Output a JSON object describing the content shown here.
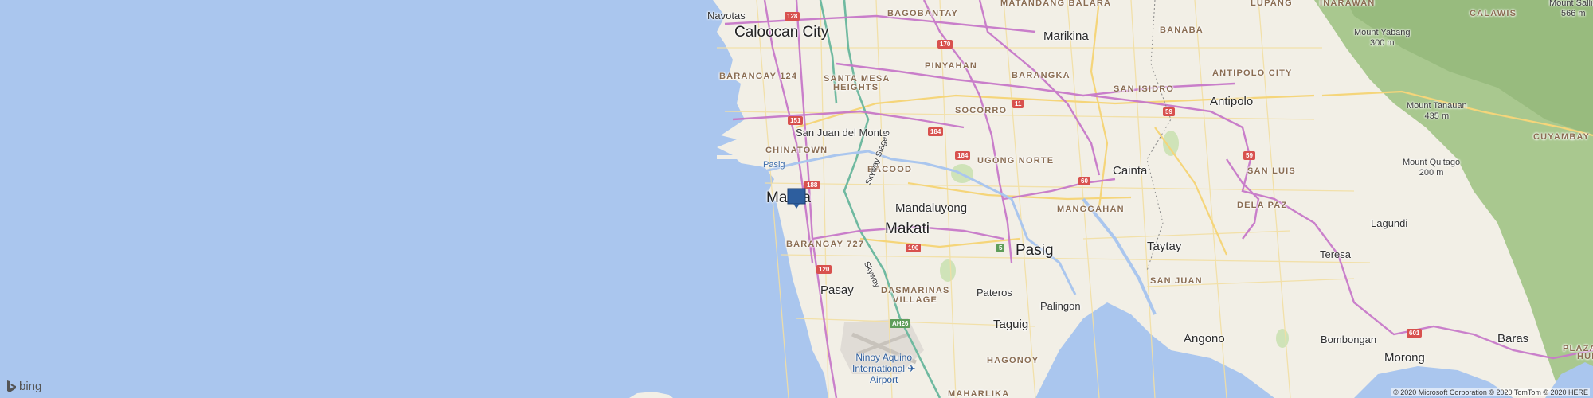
{
  "map": {
    "provider_logo": "bing",
    "copyright": "© 2020 Microsoft Corporation © 2020 TomTom © 2020 HERE",
    "marker_icon": "location-pin-icon",
    "colors": {
      "water": "#aac6ee",
      "land": "#f2efe6",
      "highway": "#c779c9",
      "major_road": "#f5d57a",
      "park": "#cfe3b8",
      "mountains": "#a9c88f",
      "marker": "#2d5e9e"
    },
    "labels": {
      "navotas": "Navotas",
      "caloocan": "Caloocan City",
      "bagobantay": "BAGOBANTAY",
      "matandang_balara": "MATANDANG BALARA",
      "marikina": "Marikina",
      "banaba": "BANABA",
      "lupang": "LUPANG",
      "inarawan": "INARAWAN",
      "calawis": "CALAWIS",
      "mount_sallid": "Mount Sallid",
      "mount_sallid_elev": "566 m",
      "mount_yabang": "Mount Yabang",
      "mount_yabang_elev": "300 m",
      "barangay_124": "BARANGAY 124",
      "pinyahan": "PINYAHAN",
      "barangka": "BARANGKA",
      "santa_mesa": "SANTA MESA",
      "heights": "HEIGHTS",
      "san_isidro": "SAN ISIDRO",
      "antipolo_city": "ANTIPOLO CITY",
      "antipolo": "Antipolo",
      "mount_tanauan": "Mount Tanauan",
      "mount_tanauan_elev": "435 m",
      "cuyambay": "CUYAMBAY",
      "socorro": "SOCORRO",
      "san_juan_del_monte": "San Juan del Monte",
      "chinatown": "CHINATOWN",
      "pasig_river": "Pasig",
      "ugong_norte": "UGONG NORTE",
      "mount_quitago": "Mount Quitago",
      "mount_quitago_elev": "200 m",
      "bacood": "BACOOD",
      "cainta": "Cainta",
      "san_luis": "SAN LUIS",
      "manila": "Manila",
      "mandaluyong": "Mandaluyong",
      "manggahan": "MANGGAHAN",
      "dela_paz": "DELA PAZ",
      "makati": "Makati",
      "lagundi": "Lagundi",
      "barangay_727": "BARANGAY 727",
      "pasig": "Pasig",
      "taytay": "Taytay",
      "teresa": "Teresa",
      "san_juan": "SAN JUAN",
      "pasay": "Pasay",
      "pateros": "Pateros",
      "dasmarinas": "DASMARINAS",
      "village": "VILLAGE",
      "palingon": "Palingon",
      "taguig": "Taguig",
      "angono": "Angono",
      "bombongan": "Bombongan",
      "baras": "Baras",
      "hagonoy": "HAGONOY",
      "ninoy_1": "Ninoy Aquino",
      "ninoy_2": "International",
      "ninoy_3": "Airport",
      "morong": "Morong",
      "plaza": "PLAZA",
      "hulo": "HUL",
      "mahalika": "MAHARLIKA",
      "skyway_stage3": "Skyway Stage 3",
      "skyway": "Skyway"
    },
    "shields": {
      "r128": "128",
      "r170": "170",
      "r11": "11",
      "r151": "151",
      "r59a": "59",
      "r184a": "184",
      "r184b": "184",
      "r188": "188",
      "r60": "60",
      "r59b": "59",
      "r5": "5",
      "r190": "190",
      "r120": "120",
      "ah26": "AH26",
      "r601": "601"
    }
  }
}
